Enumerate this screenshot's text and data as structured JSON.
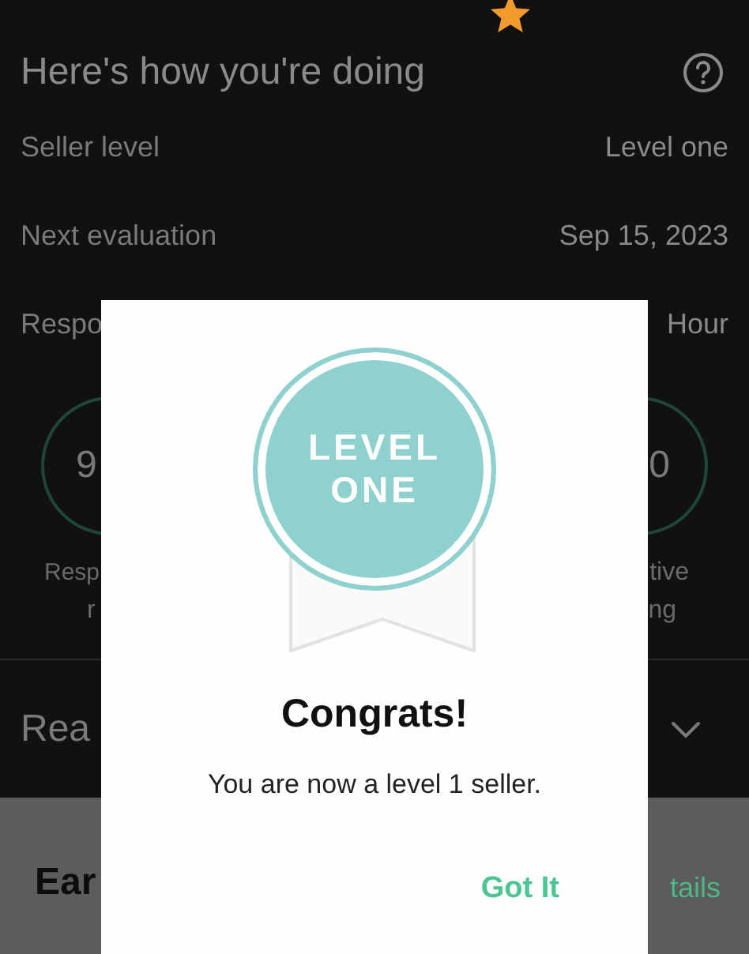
{
  "header": {
    "title": "Here's how you're doing"
  },
  "stats": [
    {
      "label": "Seller level",
      "value": "Level one"
    },
    {
      "label": "Next evaluation",
      "value": "Sep 15, 2023"
    },
    {
      "label": "Respo",
      "value": "Hour"
    }
  ],
  "metrics": [
    {
      "value": "9",
      "label_lines": [
        "Resp",
        "r"
      ]
    },
    {
      "value": "0",
      "label_lines": [
        "tive",
        "ng"
      ]
    }
  ],
  "section": {
    "title": "Rea"
  },
  "earnings": {
    "title": "Ear",
    "link": "tails"
  },
  "dialog": {
    "badge_lines": [
      "LEVEL",
      "ONE"
    ],
    "title": "Congrats!",
    "message": "You are now a level 1 seller.",
    "button": "Got It"
  }
}
